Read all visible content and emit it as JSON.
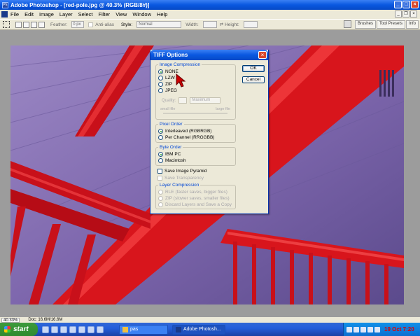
{
  "window": {
    "title": "Adobe Photoshop - [red-pole.jpg @ 40.3% (RGB/8#)]"
  },
  "menu": {
    "items": [
      "File",
      "Edit",
      "Image",
      "Layer",
      "Select",
      "Filter",
      "View",
      "Window",
      "Help"
    ]
  },
  "options": {
    "feather_label": "Feather:",
    "feather_value": "0 px",
    "antialias_label": "Anti-alias",
    "style_label": "Style:",
    "style_value": "Normal",
    "width_label": "Width:",
    "height_label": "Height:"
  },
  "palette_well": {
    "tabs": [
      "Brushes",
      "Tool Presets",
      "Info"
    ]
  },
  "dialog": {
    "title": "TIFF Options",
    "ok_label": "OK",
    "cancel_label": "Cancel",
    "image_compression": {
      "legend": "Image Compression",
      "options": [
        "NONE",
        "LZW",
        "ZIP",
        "JPEG"
      ],
      "selected": "NONE",
      "quality_label": "Quality:",
      "quality_select": "Maximum",
      "small_file": "small file",
      "large_file": "large file"
    },
    "pixel_order": {
      "legend": "Pixel Order",
      "options": [
        "Interleaved (RGBRGB)",
        "Per Channel (RRGGBB)"
      ],
      "selected": "Interleaved (RGBRGB)"
    },
    "byte_order": {
      "legend": "Byte Order",
      "options": [
        "IBM PC",
        "Macintosh"
      ],
      "selected": "IBM PC"
    },
    "save_pyramid": "Save Image Pyramid",
    "save_transparency": "Save Transparency",
    "layer_compression": {
      "legend": "Layer Compression",
      "options": [
        "RLE (faster saves, bigger files)",
        "ZIP (slower saves, smaller files)",
        "Discard Layers and Save a Copy"
      ]
    }
  },
  "status": {
    "zoom": "40.33%",
    "doc": "Doc: 16.6M/16.6M"
  },
  "taskbar": {
    "start_label": "start",
    "tasks": [
      "pas",
      "Adobe Photosh..."
    ],
    "clock": "19 Oct 7:20"
  },
  "colors": {
    "pole_red": "#d8151c",
    "wall_purple": "#7f66a8",
    "xp_blue": "#0a58e0"
  }
}
